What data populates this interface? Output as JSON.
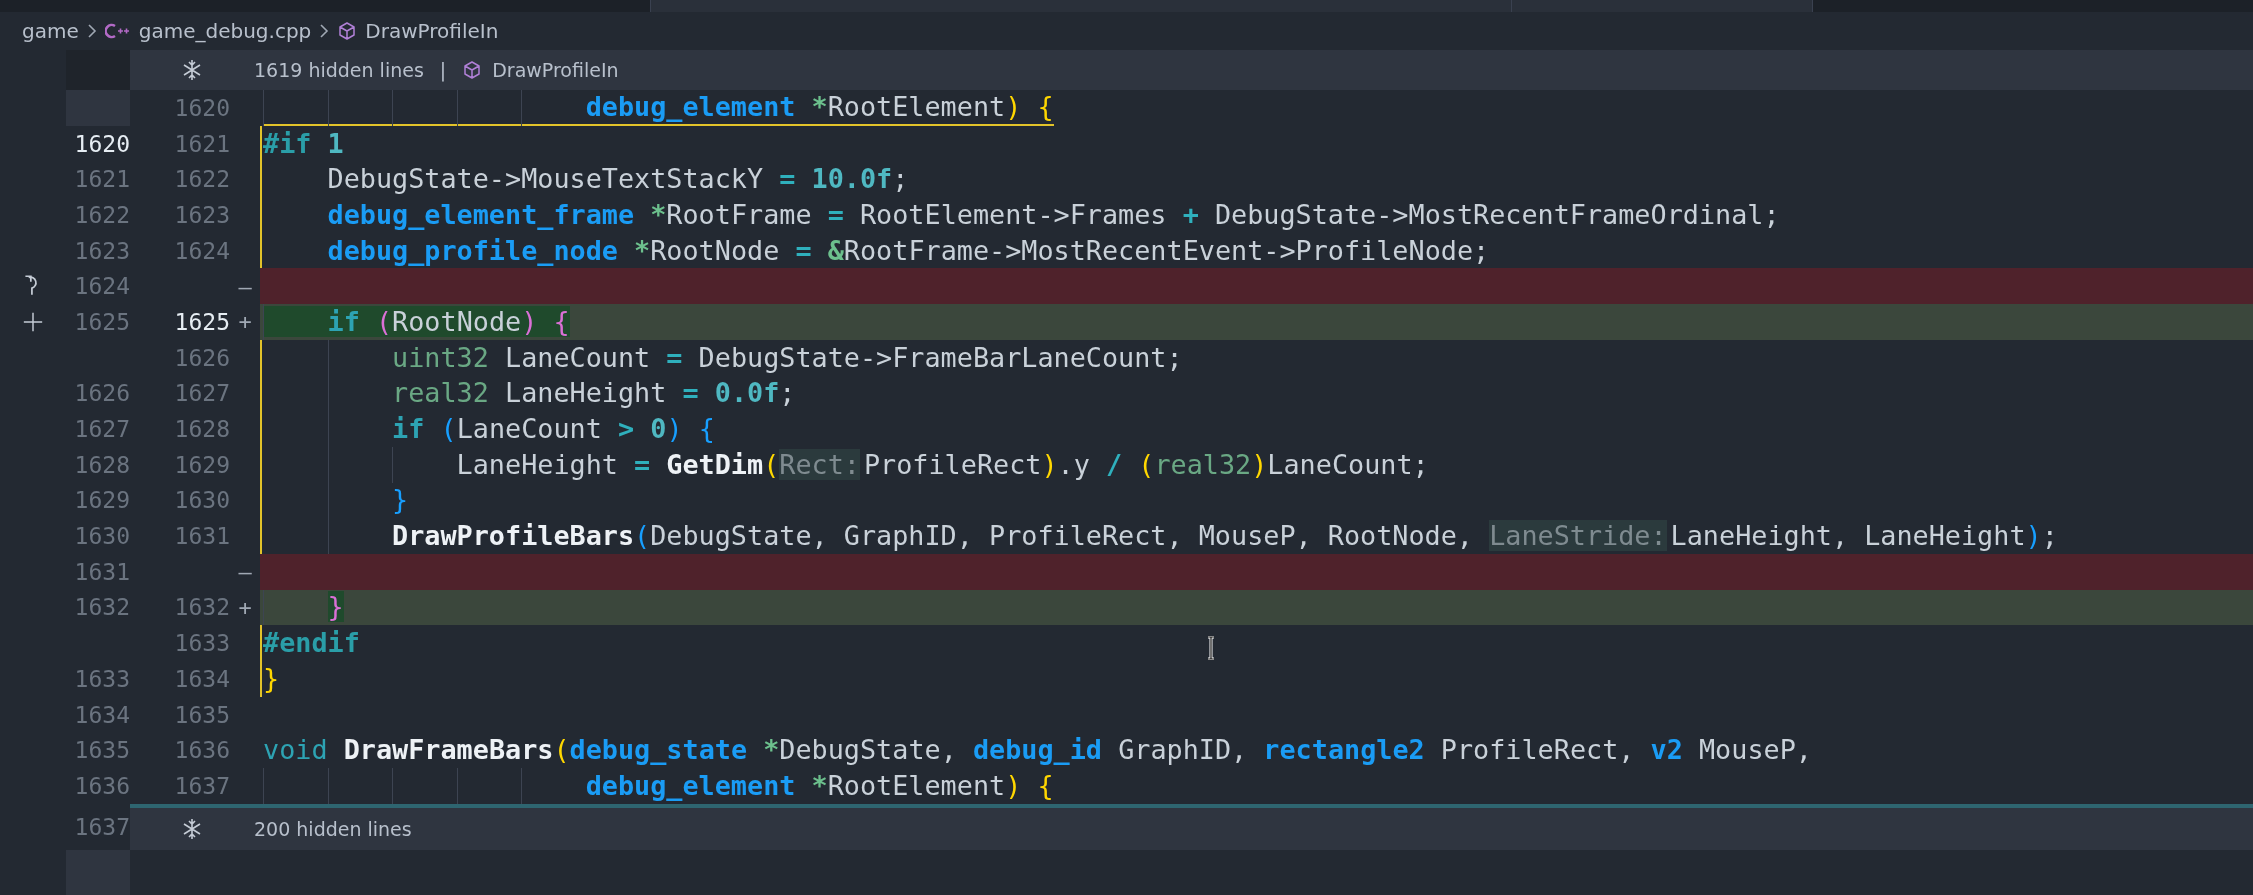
{
  "breadcrumb": [
    {
      "label": "game"
    },
    {
      "label": "game_debug.cpp"
    },
    {
      "label": "DrawProfileIn"
    }
  ],
  "rows": [
    {
      "kind": "hidden",
      "accent": false,
      "label": "1619 hidden lines",
      "separator": "|",
      "symbol": "DrawProfileIn"
    },
    {
      "kind": "context",
      "mod": "1620",
      "gutter_shade": true,
      "region_top": true,
      "tokens": [
        {
          "kind": "kw",
          "text": "                    debug_element"
        },
        {
          "kind": "ptr",
          "text": " *"
        },
        {
          "kind": "text",
          "text": "RootElement"
        },
        {
          "kind": "br-y",
          "text": ")"
        },
        {
          "kind": "br-y",
          "text": " {"
        }
      ]
    },
    {
      "kind": "context",
      "orig": "1620",
      "mod": "1621",
      "orig_active": true,
      "changed_region": true,
      "tokens": [
        {
          "kind": "pre",
          "text": "#if"
        },
        {
          "kind": "num",
          "text": " 1"
        }
      ]
    },
    {
      "kind": "context",
      "orig": "1621",
      "mod": "1622",
      "changed_region": true,
      "tokens": [
        {
          "kind": "text",
          "text": "    DebugState->MouseTextStackY "
        },
        {
          "kind": "op",
          "text": "="
        },
        {
          "kind": "num",
          "text": " 10.0f"
        },
        {
          "kind": "text",
          "text": ";"
        }
      ]
    },
    {
      "kind": "context",
      "orig": "1622",
      "mod": "1623",
      "changed_region": true,
      "tokens": [
        {
          "kind": "kw",
          "text": "    debug_element_frame"
        },
        {
          "kind": "ptr",
          "text": " *"
        },
        {
          "kind": "text",
          "text": "RootFrame "
        },
        {
          "kind": "op",
          "text": "="
        },
        {
          "kind": "text",
          "text": " RootElement->Frames "
        },
        {
          "kind": "op",
          "text": "+"
        },
        {
          "kind": "text",
          "text": " DebugState->MostRecentFrameOrdinal;"
        }
      ]
    },
    {
      "kind": "context",
      "orig": "1623",
      "mod": "1624",
      "changed_region": true,
      "tokens": [
        {
          "kind": "kw",
          "text": "    debug_profile_node"
        },
        {
          "kind": "ptr",
          "text": " *"
        },
        {
          "kind": "text",
          "text": "RootNode "
        },
        {
          "kind": "op",
          "text": "="
        },
        {
          "kind": "ptr",
          "text": " &"
        },
        {
          "kind": "text",
          "text": "RootFrame->MostRecentEvent->ProfileNode;"
        }
      ]
    },
    {
      "kind": "removed",
      "orig": "1624",
      "sign": "—",
      "revertible": true
    },
    {
      "kind": "added",
      "orig": "1625",
      "mod": "1625",
      "sign": "+",
      "mod_active": true,
      "stageable": true,
      "highlight_indent": true,
      "inserted": [
        {
          "kind": "ctrl",
          "text": "    if"
        },
        {
          "kind": "br-p",
          "text": " ("
        },
        {
          "kind": "text",
          "text": "RootNode"
        },
        {
          "kind": "br-p",
          "text": ")"
        },
        {
          "kind": "br-p",
          "text": " {"
        }
      ]
    },
    {
      "kind": "context",
      "mod": "1626",
      "changed_region": true,
      "tokens": [
        {
          "kind": "type",
          "text": "        uint32"
        },
        {
          "kind": "text",
          "text": " LaneCount "
        },
        {
          "kind": "op",
          "text": "="
        },
        {
          "kind": "text",
          "text": " DebugState->FrameBarLaneCount;"
        }
      ]
    },
    {
      "kind": "context",
      "orig": "1626",
      "mod": "1627",
      "changed_region": true,
      "tokens": [
        {
          "kind": "type",
          "text": "        real32"
        },
        {
          "kind": "text",
          "text": " LaneHeight "
        },
        {
          "kind": "op",
          "text": "="
        },
        {
          "kind": "num",
          "text": " 0.0f"
        },
        {
          "kind": "text",
          "text": ";"
        }
      ]
    },
    {
      "kind": "context",
      "orig": "1627",
      "mod": "1628",
      "changed_region": true,
      "tokens": [
        {
          "kind": "ctrl",
          "text": "        if"
        },
        {
          "kind": "br-b",
          "text": " ("
        },
        {
          "kind": "text",
          "text": "LaneCount "
        },
        {
          "kind": "op",
          "text": ">"
        },
        {
          "kind": "num",
          "text": " 0"
        },
        {
          "kind": "br-b",
          "text": ")"
        },
        {
          "kind": "br-b",
          "text": " {"
        }
      ]
    },
    {
      "kind": "context",
      "orig": "1628",
      "mod": "1629",
      "changed_region": true,
      "tokens": [
        {
          "kind": "text",
          "text": "            LaneHeight "
        },
        {
          "kind": "op",
          "text": "="
        },
        {
          "kind": "func",
          "text": " GetDim"
        },
        {
          "kind": "br-y",
          "text": "("
        },
        {
          "kind": "hint",
          "text": "Rect:"
        },
        {
          "kind": "text",
          "text": "ProfileRect"
        },
        {
          "kind": "br-y",
          "text": ")"
        },
        {
          "kind": "text",
          "text": ".y "
        },
        {
          "kind": "op",
          "text": "/"
        },
        {
          "kind": "br-y",
          "text": " ("
        },
        {
          "kind": "type",
          "text": "real32"
        },
        {
          "kind": "br-y",
          "text": ")"
        },
        {
          "kind": "text",
          "text": "LaneCount;"
        }
      ]
    },
    {
      "kind": "context",
      "orig": "1629",
      "mod": "1630",
      "changed_region": true,
      "tokens": [
        {
          "kind": "br-b",
          "text": "        }"
        }
      ]
    },
    {
      "kind": "context",
      "orig": "1630",
      "mod": "1631",
      "changed_region": true,
      "tokens": [
        {
          "kind": "func",
          "text": "        DrawProfileBars"
        },
        {
          "kind": "br-b",
          "text": "("
        },
        {
          "kind": "text",
          "text": "DebugState, GraphID, ProfileRect, MouseP, RootNode, "
        },
        {
          "kind": "hint",
          "text": "LaneStride:"
        },
        {
          "kind": "text",
          "text": "LaneHeight, LaneHeight"
        },
        {
          "kind": "br-b",
          "text": ")"
        },
        {
          "kind": "text",
          "text": ";"
        }
      ]
    },
    {
      "kind": "removed",
      "orig": "1631",
      "sign": "—",
      "revertible": false
    },
    {
      "kind": "added",
      "orig": "1632",
      "mod": "1632",
      "sign": "+",
      "stageable": false,
      "highlight_indent": false,
      "inserted": [
        {
          "kind": "br-p",
          "text": "    }"
        }
      ]
    },
    {
      "kind": "context",
      "mod": "1633",
      "changed_region": true,
      "tokens": [
        {
          "kind": "pre",
          "text": "#endif"
        }
      ]
    },
    {
      "kind": "context",
      "orig": "1633",
      "mod": "1634",
      "changed_region": true,
      "tokens": [
        {
          "kind": "br-y",
          "text": "}"
        }
      ]
    },
    {
      "kind": "context",
      "orig": "1634",
      "mod": "1635"
    },
    {
      "kind": "context",
      "orig": "1635",
      "mod": "1636",
      "tokens": [
        {
          "kind": "void",
          "text": "void"
        },
        {
          "kind": "func",
          "text": " DrawFrameBars"
        },
        {
          "kind": "br-y",
          "text": "("
        },
        {
          "kind": "kw",
          "text": "debug_state"
        },
        {
          "kind": "ptr",
          "text": " *"
        },
        {
          "kind": "text",
          "text": "DebugState, "
        },
        {
          "kind": "kw",
          "text": "debug_id"
        },
        {
          "kind": "text",
          "text": " GraphID, "
        },
        {
          "kind": "kw",
          "text": "rectangle2"
        },
        {
          "kind": "text",
          "text": " ProfileRect, "
        },
        {
          "kind": "kw",
          "text": "v2"
        },
        {
          "kind": "text",
          "text": " MouseP,"
        }
      ]
    },
    {
      "kind": "context",
      "orig": "1636",
      "mod": "1637",
      "tokens": [
        {
          "kind": "kw",
          "text": "                    debug_element"
        },
        {
          "kind": "ptr",
          "text": " *"
        },
        {
          "kind": "text",
          "text": "RootElement"
        },
        {
          "kind": "br-y",
          "text": ")"
        },
        {
          "kind": "br-y",
          "text": " {"
        }
      ]
    },
    {
      "kind": "hidden",
      "accent": true,
      "orig": "1637",
      "label": "200 hidden lines"
    }
  ]
}
